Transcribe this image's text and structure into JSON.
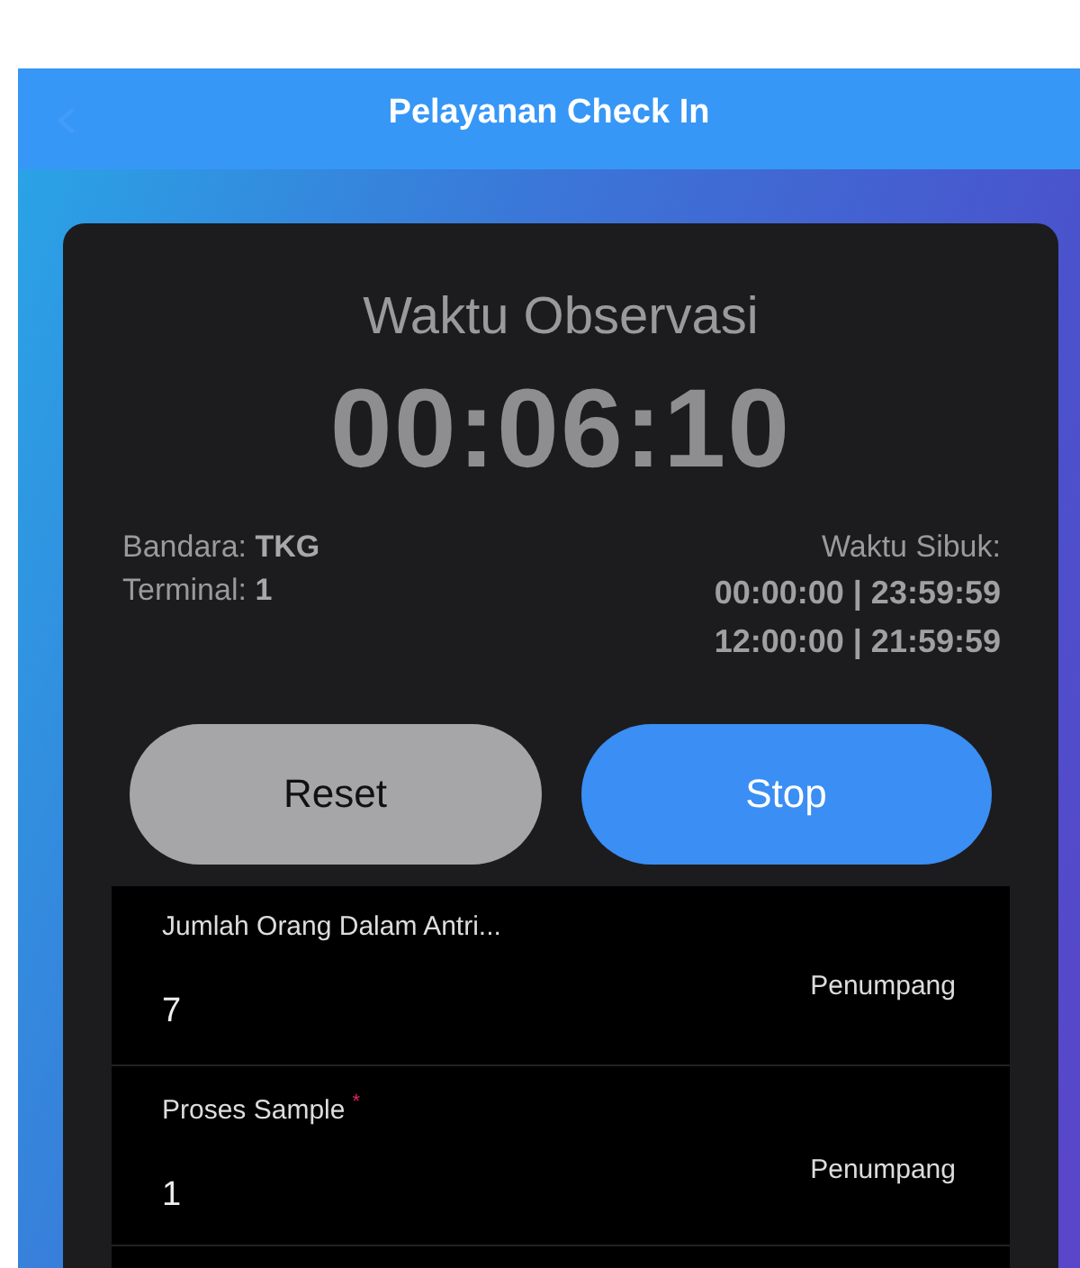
{
  "header": {
    "title": "Pelayanan Check In"
  },
  "observation": {
    "title": "Waktu Observasi",
    "timer": "00:06:10"
  },
  "info": {
    "airport_label": "Bandara:",
    "airport": "TKG",
    "terminal_label": "Terminal:",
    "terminal": "1",
    "busy_label": "Waktu Sibuk:",
    "busy_times": [
      "00:00:00 | 23:59:59",
      "12:00:00 | 21:59:59"
    ]
  },
  "buttons": [
    {
      "label": "Reset",
      "kind": "secondary"
    },
    {
      "label": "Stop",
      "kind": "primary"
    }
  ],
  "fields": [
    {
      "label": "Jumlah Orang Dalam Antri...",
      "value": "7",
      "unit": "Penumpang"
    },
    {
      "label": "Proses Sample",
      "required_mark": "*",
      "value": "1",
      "unit": "Penumpang"
    }
  ]
}
